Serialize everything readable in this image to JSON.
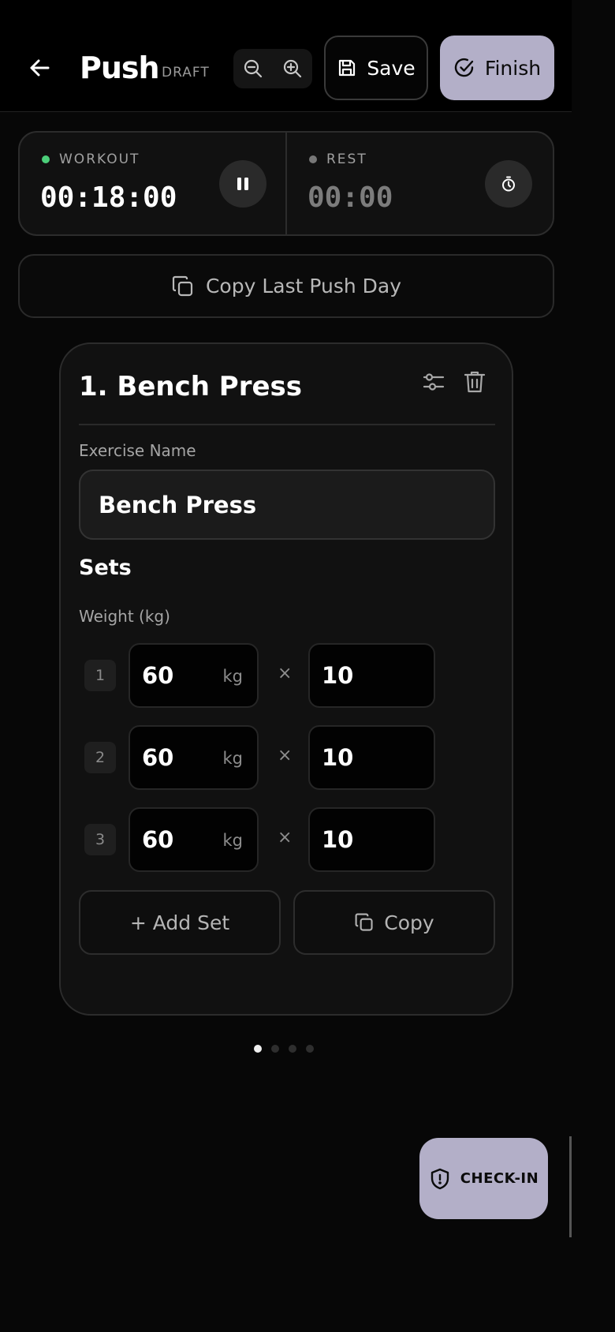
{
  "header": {
    "title": "Push",
    "status": "DRAFT",
    "save_label": "Save",
    "finish_label": "Finish"
  },
  "timers": {
    "workout": {
      "label": "WORKOUT",
      "value": "00:18:00",
      "status_color": "#4ccf7a"
    },
    "rest": {
      "label": "REST",
      "value": "00:00",
      "status_color": "#777777"
    }
  },
  "copy_last_label": "Copy Last Push Day",
  "exercise": {
    "title": "1. Bench Press",
    "name_label": "Exercise Name",
    "name_value": "Bench Press",
    "sets_heading": "Sets",
    "weight_label": "Weight (kg)",
    "sets": [
      {
        "num": "1",
        "weight": "60",
        "unit": "kg",
        "times": "×",
        "reps": "10"
      },
      {
        "num": "2",
        "weight": "60",
        "unit": "kg",
        "times": "×",
        "reps": "10"
      },
      {
        "num": "3",
        "weight": "60",
        "unit": "kg",
        "times": "×",
        "reps": "10"
      }
    ],
    "add_set_label": "+ Add Set",
    "copy_label": "Copy"
  },
  "pagination": {
    "pages": 4,
    "current": 1
  },
  "checkin_label": "CHECK-IN",
  "colors": {
    "accent": "#b3afc8",
    "background": "#070707"
  }
}
